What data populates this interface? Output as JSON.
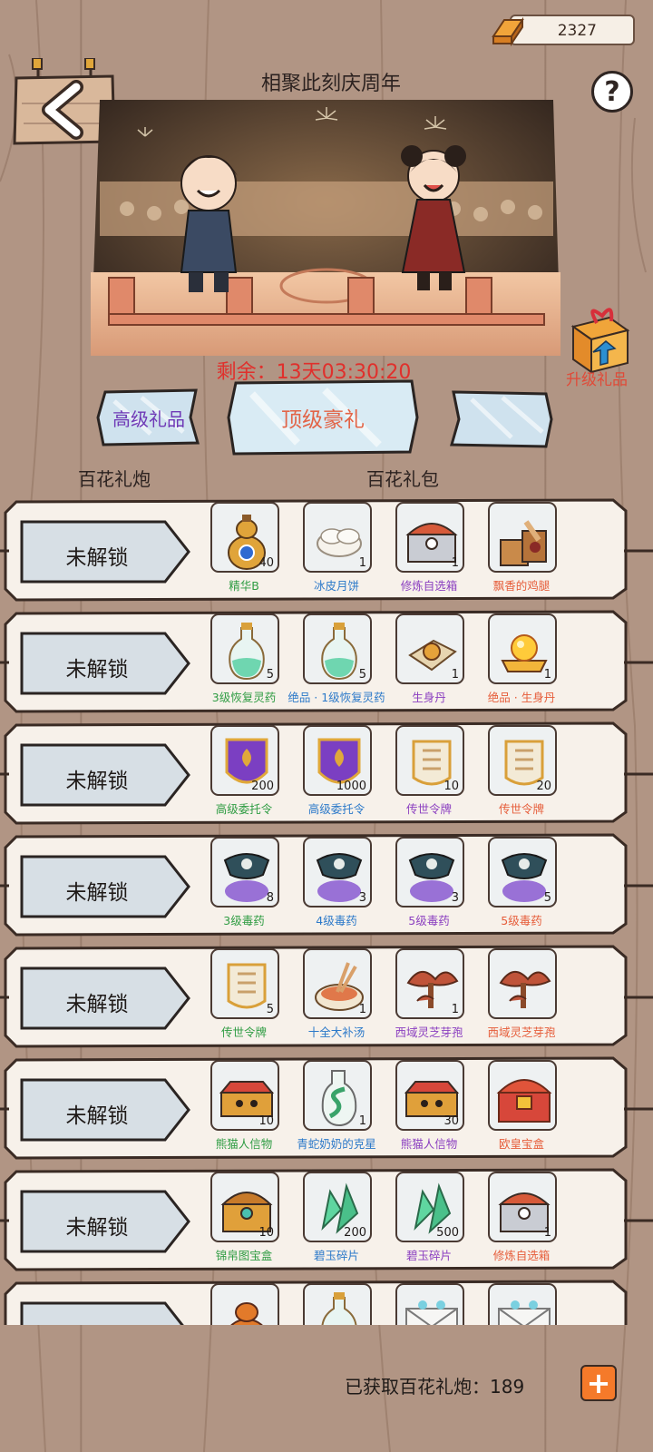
{
  "header": {
    "gold_amount": "2327",
    "title": "相聚此刻庆周年",
    "help_label": "?"
  },
  "banner": {
    "countdown": "剩余：13天03:30:20",
    "upgrade_label": "升级礼品"
  },
  "tabs": [
    {
      "label": "高级礼品"
    },
    {
      "label": "顶级豪礼"
    },
    {
      "label": ""
    }
  ],
  "columns": {
    "left": "百花礼炮",
    "right": "百花礼包"
  },
  "rows": [
    {
      "lock_label": "未解锁",
      "items": [
        {
          "icon": "essence-gourd-icon",
          "name": "精华B",
          "count": "40",
          "color": "green"
        },
        {
          "icon": "mooncake-icon",
          "name": "冰皮月饼",
          "count": "1",
          "color": "blue"
        },
        {
          "icon": "selection-chest-icon",
          "name": "修炼自选箱",
          "count": "1",
          "color": "purple"
        },
        {
          "icon": "chicken-leg-icon",
          "name": "飘香的鸡腿",
          "count": "",
          "color": "orange"
        }
      ]
    },
    {
      "lock_label": "未解锁",
      "items": [
        {
          "icon": "potion-bottle-icon",
          "name": "3级恢复灵药",
          "count": "5",
          "color": "green"
        },
        {
          "icon": "potion-bottle-icon",
          "name": "绝品 · 1级恢复灵药",
          "count": "5",
          "color": "blue"
        },
        {
          "icon": "pill-icon",
          "name": "生身丹",
          "count": "1",
          "color": "purple"
        },
        {
          "icon": "golden-pill-icon",
          "name": "绝品 · 生身丹",
          "count": "1",
          "color": "orange"
        }
      ]
    },
    {
      "lock_label": "未解锁",
      "items": [
        {
          "icon": "purple-token-icon",
          "name": "高级委托令",
          "count": "200",
          "color": "green"
        },
        {
          "icon": "purple-token-icon",
          "name": "高级委托令",
          "count": "1000",
          "color": "blue"
        },
        {
          "icon": "legacy-token-icon",
          "name": "传世令牌",
          "count": "10",
          "color": "purple"
        },
        {
          "icon": "legacy-token-icon",
          "name": "传世令牌",
          "count": "20",
          "color": "orange"
        }
      ]
    },
    {
      "lock_label": "未解锁",
      "items": [
        {
          "icon": "poison-pouch-icon",
          "name": "3级毒药",
          "count": "8",
          "color": "green"
        },
        {
          "icon": "poison-pouch-icon",
          "name": "4级毒药",
          "count": "3",
          "color": "blue"
        },
        {
          "icon": "poison-pouch-icon",
          "name": "5级毒药",
          "count": "3",
          "color": "purple"
        },
        {
          "icon": "poison-pouch-icon",
          "name": "5级毒药",
          "count": "5",
          "color": "orange"
        }
      ]
    },
    {
      "lock_label": "未解锁",
      "items": [
        {
          "icon": "legacy-token-icon",
          "name": "传世令牌",
          "count": "5",
          "color": "green"
        },
        {
          "icon": "tonic-soup-icon",
          "name": "十全大补汤",
          "count": "1",
          "color": "blue"
        },
        {
          "icon": "lingzhi-icon",
          "name": "西域灵芝芽孢",
          "count": "1",
          "color": "purple"
        },
        {
          "icon": "lingzhi-icon",
          "name": "西域灵芝芽孢",
          "count": "",
          "color": "orange"
        }
      ]
    },
    {
      "lock_label": "未解锁",
      "items": [
        {
          "icon": "panda-box-icon",
          "name": "熊猫人信物",
          "count": "10",
          "color": "green"
        },
        {
          "icon": "snake-bottle-icon",
          "name": "青蛇奶奶的克星",
          "count": "1",
          "color": "blue"
        },
        {
          "icon": "panda-box-icon",
          "name": "熊猫人信物",
          "count": "30",
          "color": "purple"
        },
        {
          "icon": "royal-chest-icon",
          "name": "欧皇宝盒",
          "count": "",
          "color": "orange"
        }
      ]
    },
    {
      "lock_label": "未解锁",
      "items": [
        {
          "icon": "brocade-chest-icon",
          "name": "锦帛图宝盒",
          "count": "10",
          "color": "green"
        },
        {
          "icon": "jade-shard-icon",
          "name": "碧玉碎片",
          "count": "200",
          "color": "blue"
        },
        {
          "icon": "jade-shard-icon",
          "name": "碧玉碎片",
          "count": "500",
          "color": "purple"
        },
        {
          "icon": "selection-chest-icon",
          "name": "修炼自选箱",
          "count": "1",
          "color": "orange"
        }
      ]
    },
    {
      "lock_label": "未解锁",
      "items": [
        {
          "icon": "orange-gourd-icon",
          "name": "",
          "count": "",
          "color": "green"
        },
        {
          "icon": "potion-bottle-icon",
          "name": "",
          "count": "",
          "color": "blue"
        },
        {
          "icon": "envelope-icon",
          "name": "",
          "count": "",
          "color": "purple"
        },
        {
          "icon": "envelope-icon",
          "name": "",
          "count": "",
          "color": "orange"
        }
      ]
    }
  ],
  "footer": {
    "collected_label": "已获取百花礼炮：",
    "collected_count": "189",
    "plus_label": "+"
  }
}
